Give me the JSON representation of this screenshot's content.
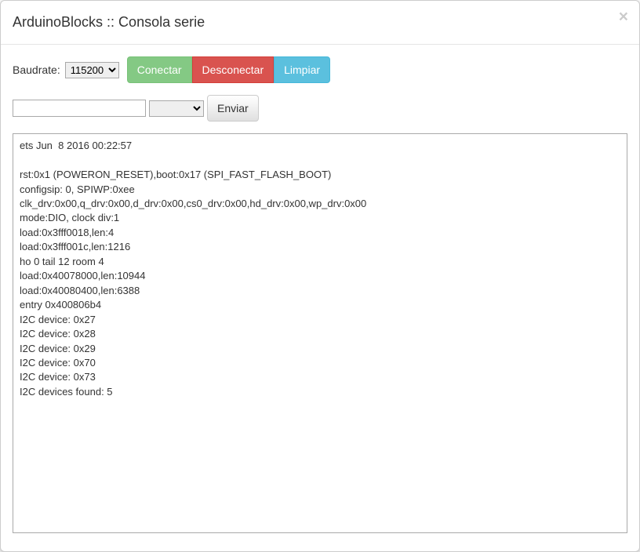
{
  "header": {
    "title": "ArduinoBlocks :: Consola serie",
    "close_symbol": "×"
  },
  "toolbar": {
    "baudrate_label": "Baudrate:",
    "baudrate_value": "115200",
    "connect_label": "Conectar",
    "disconnect_label": "Desconectar",
    "clear_label": "Limpiar"
  },
  "send": {
    "input_value": "",
    "line_ending_value": "",
    "send_label": "Enviar"
  },
  "console": {
    "output": "ets Jun  8 2016 00:22:57\n\nrst:0x1 (POWERON_RESET),boot:0x17 (SPI_FAST_FLASH_BOOT)\nconfigsip: 0, SPIWP:0xee\nclk_drv:0x00,q_drv:0x00,d_drv:0x00,cs0_drv:0x00,hd_drv:0x00,wp_drv:0x00\nmode:DIO, clock div:1\nload:0x3fff0018,len:4\nload:0x3fff001c,len:1216\nho 0 tail 12 room 4\nload:0x40078000,len:10944\nload:0x40080400,len:6388\nentry 0x400806b4\nI2C device: 0x27\nI2C device: 0x28\nI2C device: 0x29\nI2C device: 0x70\nI2C device: 0x73\nI2C devices found: 5\n"
  }
}
